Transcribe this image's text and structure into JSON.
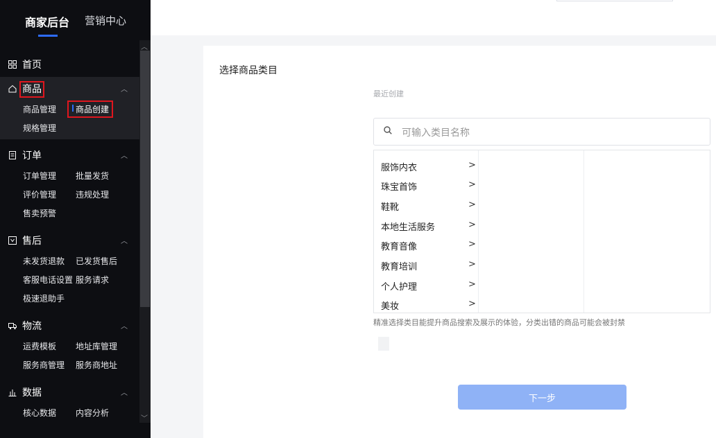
{
  "top_tabs": {
    "active": "商家后台",
    "inactive": "营销中心"
  },
  "sidebar": {
    "home": "首页",
    "product": {
      "title": "商品",
      "items": [
        "商品管理",
        "商品创建",
        "规格管理"
      ]
    },
    "order": {
      "title": "订单",
      "items": [
        "订单管理",
        "批量发货",
        "评价管理",
        "违规处理",
        "售卖预警"
      ]
    },
    "aftersale": {
      "title": "售后",
      "items": [
        "未发货退款",
        "已发货售后",
        "客服电话设置",
        "服务请求",
        "极速退助手"
      ]
    },
    "logistics": {
      "title": "物流",
      "items": [
        "运费模板",
        "地址库管理",
        "服务商管理",
        "服务商地址"
      ]
    },
    "data": {
      "title": "数据",
      "items": [
        "核心数据",
        "内容分析"
      ]
    }
  },
  "panel": {
    "title": "选择商品类目",
    "recent": "最近创建",
    "search_placeholder": "可输入类目名称",
    "categories": [
      "服饰内衣",
      "珠宝首饰",
      "鞋靴",
      "本地生活服务",
      "教育音像",
      "教育培训",
      "个人护理",
      "美妆"
    ],
    "hint": "精准选择类目能提升商品搜索及展示的体验，分类出错的商品可能会被封禁",
    "next": "下一步"
  },
  "colors": {
    "sidebar_bg": "#0d0e12",
    "accent": "#2d6cff",
    "highlight": "#e0161e",
    "button": "#8fb2f6"
  },
  "icons": [
    "grid-icon",
    "home-icon",
    "document-icon",
    "return-icon",
    "truck-icon",
    "bar-chart-icon",
    "search-icon",
    "chevron-right-icon",
    "chevron-up-icon"
  ]
}
